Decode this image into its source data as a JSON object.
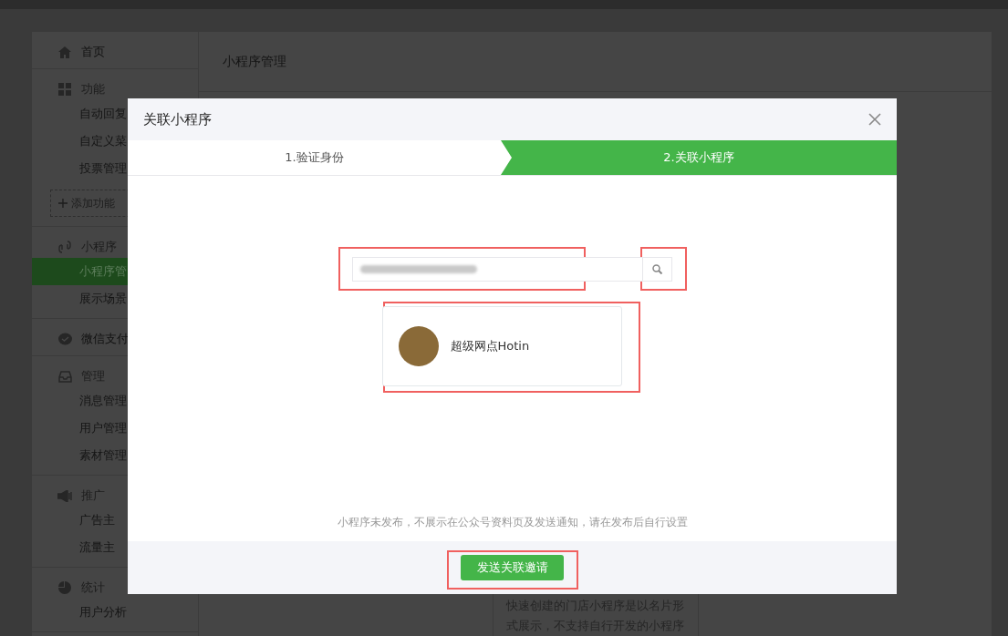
{
  "sidebar": {
    "sections": [
      {
        "title": "首页"
      },
      {
        "title": "功能",
        "items": [
          {
            "label": "自动回复",
            "selected": false
          },
          {
            "label": "自定义菜",
            "selected": false
          },
          {
            "label": "投票管理",
            "selected": false
          }
        ],
        "add_button": "添加功能"
      },
      {
        "title": "小程序",
        "items": [
          {
            "label": "小程序管",
            "selected": true
          },
          {
            "label": "展示场景",
            "selected": false
          }
        ]
      },
      {
        "title": "微信支付"
      },
      {
        "title": "管理",
        "items": [
          {
            "label": "消息管理",
            "selected": false
          },
          {
            "label": "用户管理",
            "selected": false
          },
          {
            "label": "素材管理",
            "selected": false
          }
        ]
      },
      {
        "title": "推广",
        "items": [
          {
            "label": "广告主",
            "selected": false
          },
          {
            "label": "流量主",
            "selected": false
          }
        ]
      },
      {
        "title": "统计",
        "items": [
          {
            "label": "用户分析",
            "selected": false
          }
        ]
      }
    ]
  },
  "main": {
    "title": "小程序管理",
    "card_text": "快速创建的门店小程序是以名片形式展示，不支持自行开发的小程序"
  },
  "dialog": {
    "title": "关联小程序",
    "steps": [
      {
        "label": "1.验证身份",
        "selected": false
      },
      {
        "label": "2.关联小程序",
        "selected": true
      }
    ],
    "result": {
      "name": "超级网点Hotin"
    },
    "notice": "小程序未发布，不展示在公众号资料页及发送通知，请在发布后自行设置",
    "button": "发送关联邀请"
  }
}
